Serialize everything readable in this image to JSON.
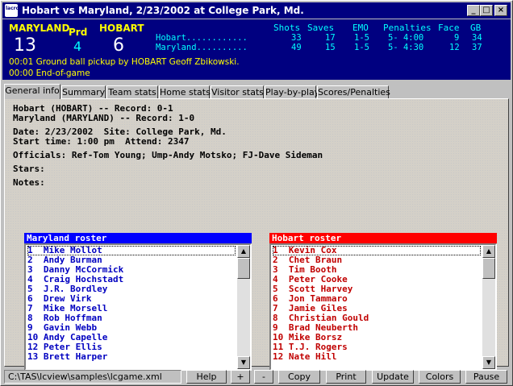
{
  "window": {
    "title": "Hobart vs Maryland, 2/23/2002 at College Park, Md.",
    "icon_text": "lacrosse"
  },
  "scoreboard": {
    "home_name": "MARYLAND",
    "home_score": "13",
    "period_label": "Prd",
    "period_value": "4",
    "visitor_name": "HOBART",
    "visitor_score": "6",
    "stat_headers": [
      "Shots",
      "Saves",
      "EMO",
      "Penalties",
      "Face",
      "GB"
    ],
    "rows": [
      {
        "team": "Hobart............",
        "shots": "33",
        "saves": "17",
        "emo": "1-5",
        "penalties": "5- 4:00",
        "face": "9",
        "gb": "34"
      },
      {
        "team": "Maryland..........",
        "shots": "49",
        "saves": "15",
        "emo": "1-5",
        "penalties": "5- 4:30",
        "face": "12",
        "gb": "37"
      }
    ],
    "plays": [
      "00:01  Ground ball pickup by HOBART Geoff Zbikowski.",
      "00:00  End-of-game"
    ]
  },
  "tabs": [
    "General info",
    "Summary",
    "Team stats",
    "Home stats",
    "Visitor stats",
    "Play-by-play",
    "Scores/Penalties"
  ],
  "general": {
    "line1": "Hobart (HOBART) -- Record: 0-1",
    "line2": "Maryland (MARYLAND) -- Record: 1-0",
    "line3": "Date: 2/23/2002  Site: College Park, Md.",
    "line4": "Start time: 1:00 pm  Attend: 2347",
    "line5": "Officials: Ref-Tom Young; Ump-Andy Motsko; FJ-Dave Sideman",
    "line6": "Stars:",
    "line7": "Notes:"
  },
  "rosters": {
    "home": {
      "title": "Maryland roster",
      "color": "#0000ff",
      "text_color": "#0000c0",
      "players": [
        "1  Mike Mollot",
        "2  Andy Burman",
        "3  Danny McCormick",
        "4  Craig Hochstadt",
        "5  J.R. Bordley",
        "6  Drew Virk",
        "7  Mike Morsell",
        "8  Rob Hoffman",
        "9  Gavin Webb",
        "10 Andy Capelle",
        "12 Peter Ellis",
        "13 Brett Harper"
      ]
    },
    "visitor": {
      "title": "Hobart roster",
      "color": "#ff0000",
      "text_color": "#c00000",
      "players": [
        "1  Kevin Cox",
        "2  Chet Braun",
        "3  Tim Booth",
        "4  Peter Cooke",
        "5  Scott Harvey",
        "6  Jon Tammaro",
        "7  Jamie Giles",
        "8  Christian Gould",
        "9  Brad Neuberth",
        "10 Mike Borsz",
        "11 T.J. Rogers",
        "12 Nate Hill"
      ]
    }
  },
  "status": {
    "path": "C:\\TAS\\lcview\\samples\\lcgame.xml"
  },
  "buttons": {
    "help": "Help",
    "plus": "+",
    "minus": "-",
    "copy": "Copy",
    "print": "Print",
    "update": "Update",
    "colors": "Colors",
    "pause": "Pause"
  }
}
